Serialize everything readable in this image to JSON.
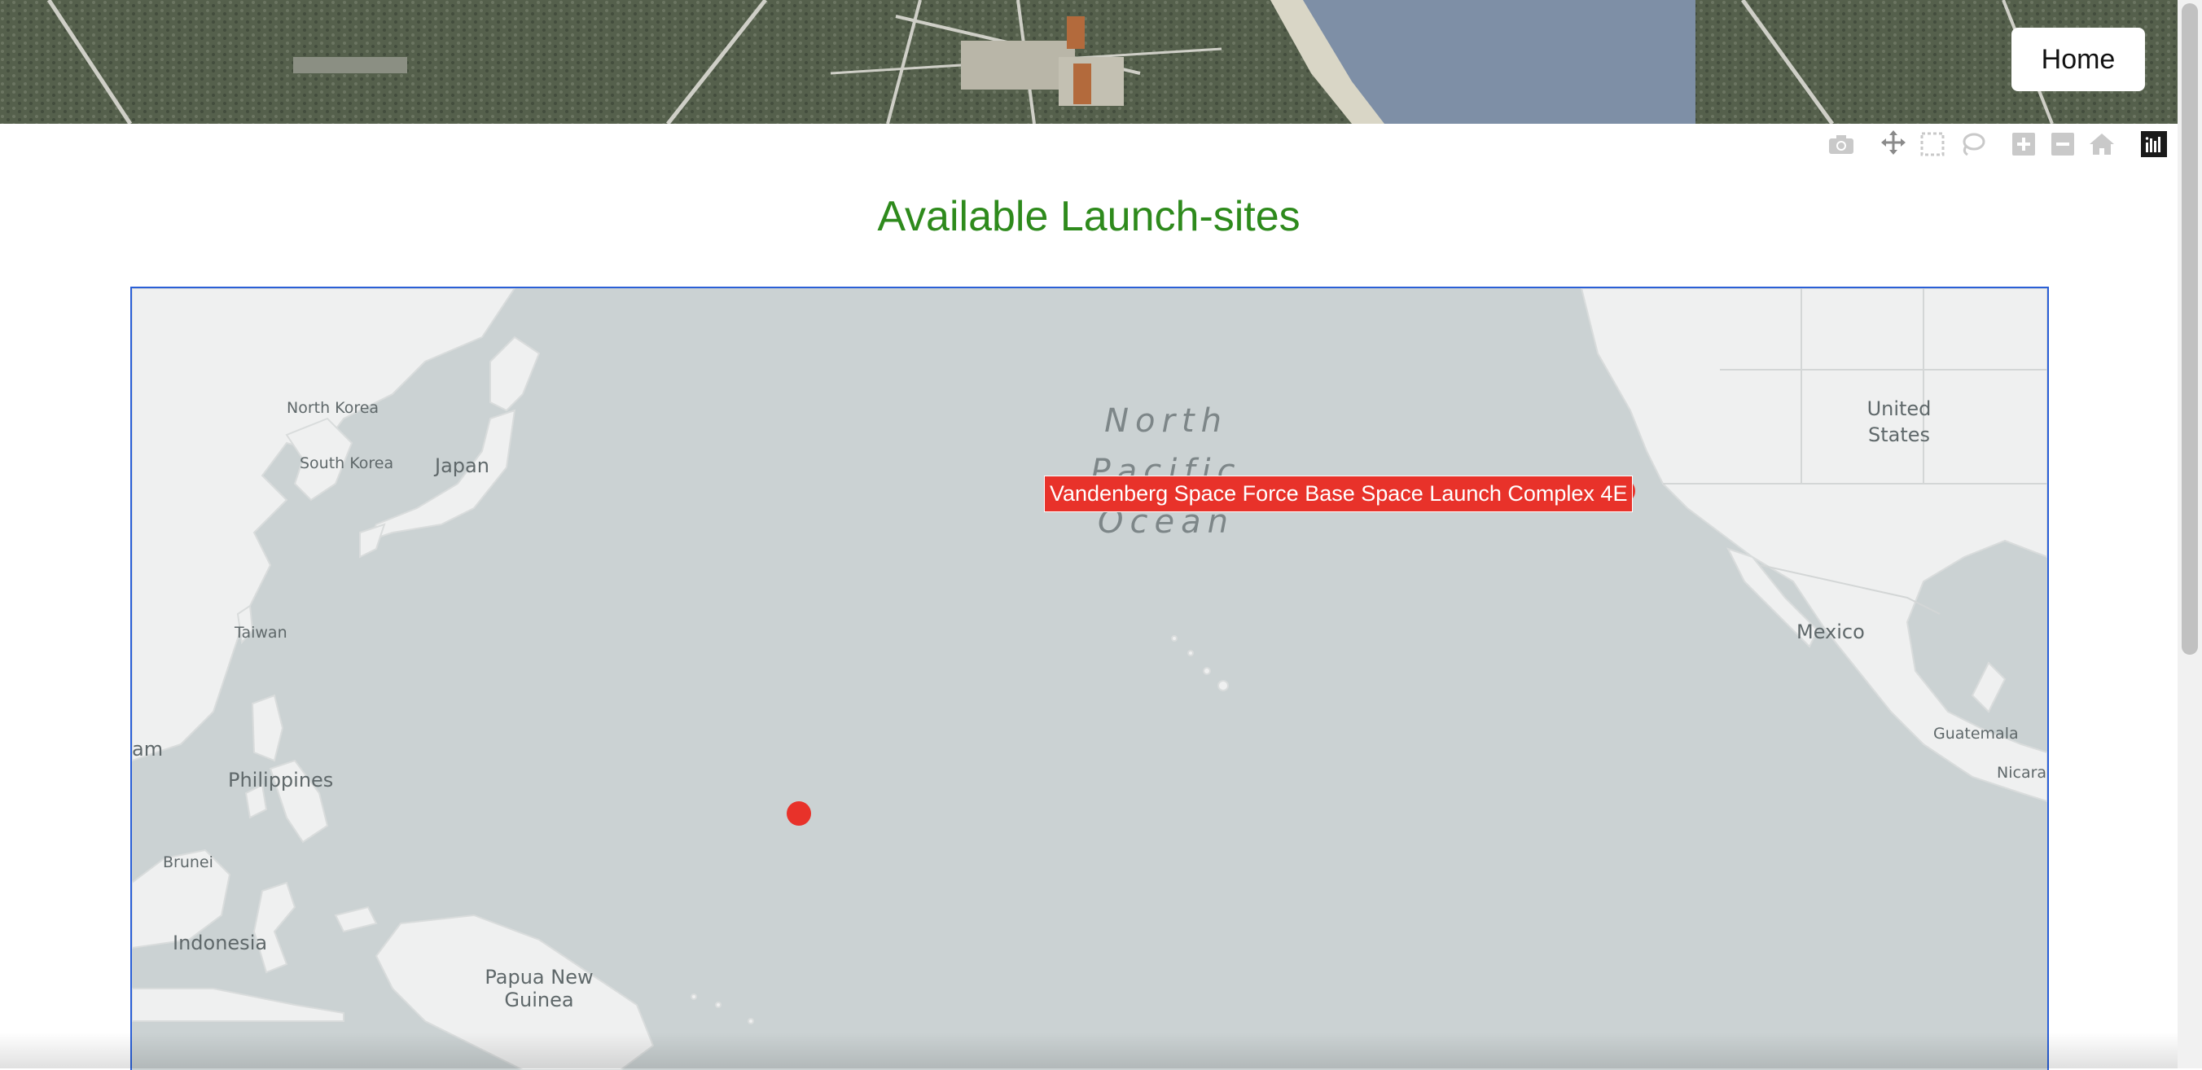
{
  "header": {
    "home_label": "Home",
    "banner_image": "launch-complex-aerial-photo"
  },
  "modebar": {
    "buttons": [
      "camera-icon",
      "pan-icon",
      "box-select-icon",
      "lasso-icon",
      "zoom-in-icon",
      "zoom-out-icon",
      "reset-home-icon",
      "plotly-logo-icon"
    ]
  },
  "page": {
    "title": "Available Launch-sites"
  },
  "map": {
    "labels": {
      "north_korea": "North Korea",
      "south_korea": "South Korea",
      "japan": "Japan",
      "taiwan": "Taiwan",
      "philippines": "Philippines",
      "vietnam_partial": "am",
      "brunei": "Brunei",
      "indonesia": "Indonesia",
      "png_line1": "Papua New",
      "png_line2": "Guinea",
      "ocean_line1": "North",
      "ocean_line2": "Pacific",
      "ocean_line3": "Ocean",
      "us_line1": "United",
      "us_line2": "States",
      "mexico": "Mexico",
      "guatemala": "Guatemala",
      "nicaragua_partial": "Nicarag"
    },
    "sites": [
      {
        "name": "Vandenberg Space Force Base Space Launch Complex 4E",
        "tooltip_visible": true
      },
      {
        "name": "",
        "tooltip_visible": false
      }
    ],
    "marker_color": "#e8322a",
    "water_color": "#cbd2d3",
    "land_color": "#eff0f0"
  }
}
